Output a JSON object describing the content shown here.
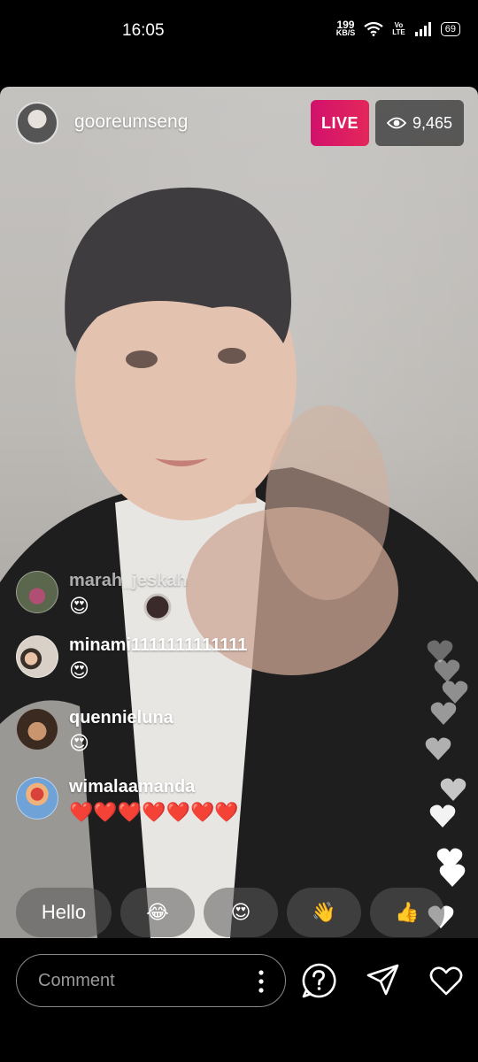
{
  "status_bar": {
    "time": "16:05",
    "net_speed_value": "199",
    "net_speed_unit": "KB/S",
    "volte_top": "Vo",
    "volte_bottom": "LTE",
    "battery": "69"
  },
  "live": {
    "host_username": "gooreumseng",
    "live_label": "LIVE",
    "viewer_count": "9,465"
  },
  "comments": [
    {
      "username": "marah_jeskah",
      "text": "😍",
      "faded": true
    },
    {
      "username": "minami1111111111111",
      "text": "😍",
      "faded": false
    },
    {
      "username": "quennieluna",
      "text": "😍",
      "faded": false
    },
    {
      "username": "wimalaamanda",
      "text": "❤️❤️❤️❤️❤️❤️❤️",
      "faded": false
    }
  ],
  "reactions": [
    "Hello",
    "😂",
    "😍",
    "👋",
    "👍"
  ],
  "input": {
    "placeholder": "Comment"
  },
  "icons": {
    "viewers": "eye-icon",
    "options": "more-vertical-icon",
    "question": "question-icon",
    "share": "send-icon",
    "gift": "gift-heart-icon"
  },
  "colors": {
    "live_badge": "#d2116c",
    "heart": "#ffffff"
  }
}
